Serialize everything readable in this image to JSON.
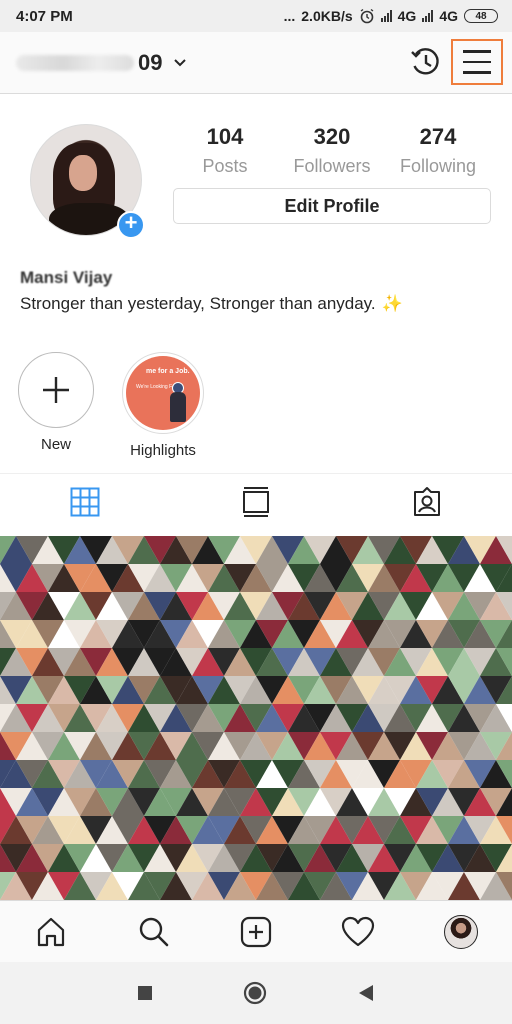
{
  "status_bar": {
    "time": "4:07 PM",
    "indicators": "...",
    "speed": "2.0KB/s",
    "network_1": "4G",
    "network_2": "4G",
    "battery": "48"
  },
  "header": {
    "username_suffix": "09",
    "chevron": "⌄"
  },
  "profile": {
    "stats": [
      {
        "value": "104",
        "label": "Posts"
      },
      {
        "value": "320",
        "label": "Followers"
      },
      {
        "value": "274",
        "label": "Following"
      }
    ],
    "edit_button": "Edit Profile",
    "name": "Mansi Vijay",
    "bio": "Stronger than yesterday, Stronger than anyday.",
    "bio_emoji": "✨",
    "add_badge": "+"
  },
  "highlights": [
    {
      "label": "New"
    },
    {
      "label": "Highlights"
    }
  ],
  "highlight_thumb": {
    "line1": "me for a Job.",
    "line2": "We're Looking For"
  },
  "icons": {
    "history": "history-icon",
    "menu": "hamburger-menu-icon",
    "grid": "grid-icon",
    "feed": "feed-icon",
    "tagged": "tagged-icon",
    "home": "home-icon",
    "search": "search-icon",
    "add": "add-post-icon",
    "activity": "heart-icon",
    "profile": "profile-avatar"
  },
  "colors": {
    "accent_blue": "#3897f0",
    "menu_highlight": "#ef7d3c",
    "active_tab": "#3897f0"
  }
}
